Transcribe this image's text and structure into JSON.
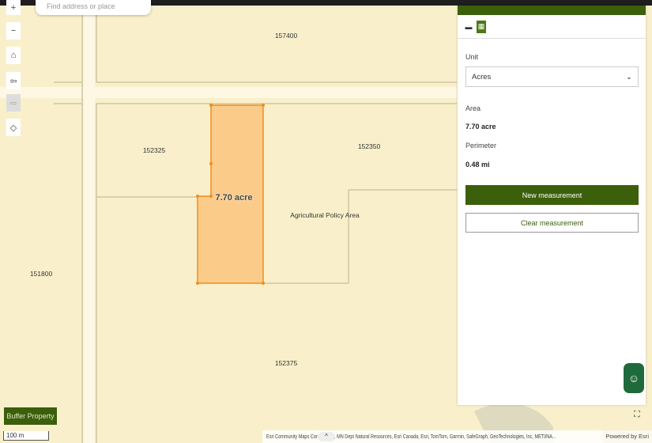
{
  "search": {
    "placeholder": "Find address or place"
  },
  "map_controls": [
    {
      "name": "zoom-in",
      "glyph": "+"
    },
    {
      "name": "zoom-out",
      "glyph": "−"
    },
    {
      "name": "home",
      "glyph": "⌂"
    },
    {
      "name": "previous-extent",
      "glyph": "⇦"
    },
    {
      "name": "next-extent",
      "glyph": "⇨"
    },
    {
      "name": "locate",
      "glyph": "◇"
    }
  ],
  "map_labels": {
    "p157400": "157400",
    "p152325": "152325",
    "p152350": "152350",
    "p151800": "151800",
    "p152375": "152375",
    "area": "Agricultural Policy Area",
    "polygon": "7.70 acre"
  },
  "panel": {
    "unit_label": "Unit",
    "unit_value": "Acres",
    "area_label": "Area",
    "area_value": "7.70 acre",
    "perimeter_label": "Perimeter",
    "perimeter_value": "0.48 mi",
    "new_button": "New measurement",
    "clear_button": "Clear measurement"
  },
  "buffer_button": "Buffer Property",
  "scale": "100 m",
  "attribution": "Esri Community Maps Contributors, MN Dept Natural Resources, Esri Canada, Esri, TomTom, Garmin, SafeGraph, GeoTechnologies, Inc, METI/NA...",
  "powered": "Powered by Esri",
  "colors": {
    "accent": "#3b5f0a",
    "map": "#f9f0cb",
    "polygon_fill": "#fbcb8a",
    "polygon_stroke": "#f28c1c"
  }
}
